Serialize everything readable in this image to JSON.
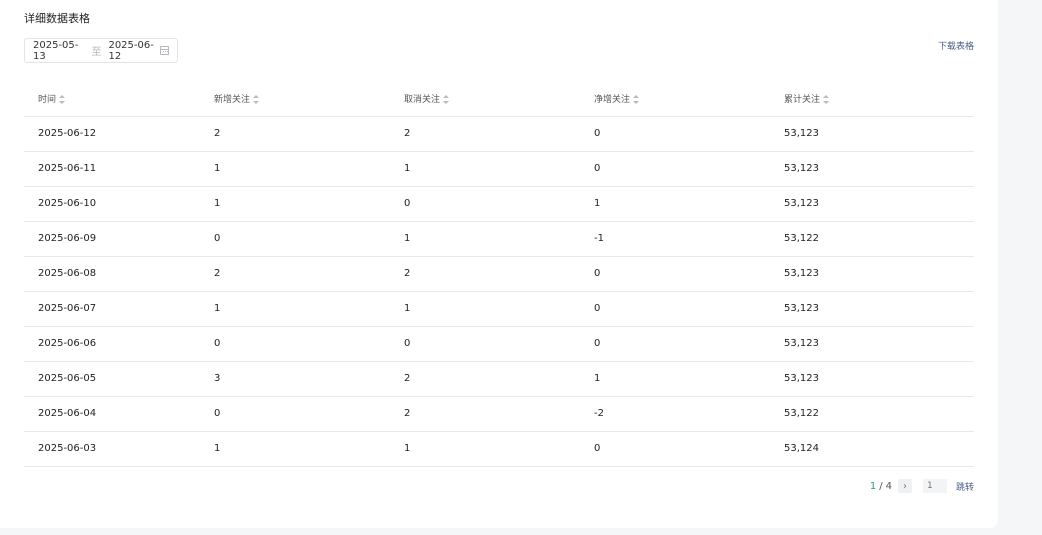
{
  "title": "详细数据表格",
  "date_range": {
    "start": "2025-05-13",
    "separator": "至",
    "end": "2025-06-12",
    "icon": "calendar-icon"
  },
  "download_label": "下载表格",
  "table": {
    "columns": [
      "时间",
      "新增关注",
      "取消关注",
      "净增关注",
      "累计关注"
    ],
    "rows": [
      [
        "2025-06-12",
        "2",
        "2",
        "0",
        "53,123"
      ],
      [
        "2025-06-11",
        "1",
        "1",
        "0",
        "53,123"
      ],
      [
        "2025-06-10",
        "1",
        "0",
        "1",
        "53,123"
      ],
      [
        "2025-06-09",
        "0",
        "1",
        "-1",
        "53,122"
      ],
      [
        "2025-06-08",
        "2",
        "2",
        "0",
        "53,123"
      ],
      [
        "2025-06-07",
        "1",
        "1",
        "0",
        "53,123"
      ],
      [
        "2025-06-06",
        "0",
        "0",
        "0",
        "53,123"
      ],
      [
        "2025-06-05",
        "3",
        "2",
        "1",
        "53,123"
      ],
      [
        "2025-06-04",
        "0",
        "2",
        "-2",
        "53,122"
      ],
      [
        "2025-06-03",
        "1",
        "1",
        "0",
        "53,124"
      ]
    ]
  },
  "pagination": {
    "current": "1",
    "separator": "/",
    "total": "4",
    "next_icon": "chevron-right-icon",
    "input_placeholder": "1",
    "jump_label": "跳转"
  },
  "colors": {
    "accent_green": "#2aa36b",
    "link": "#4a5c86",
    "border": "#e8e9eb"
  }
}
